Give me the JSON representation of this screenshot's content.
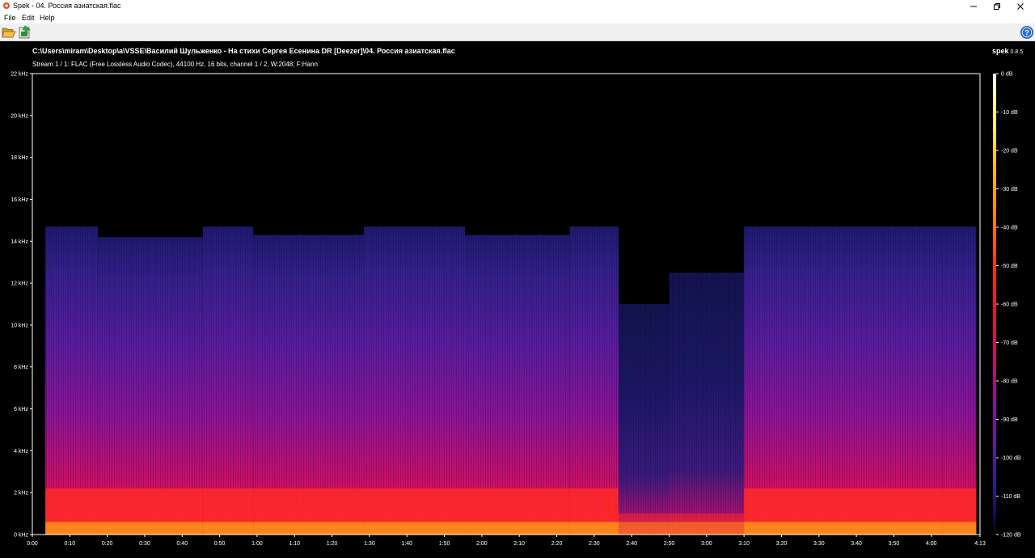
{
  "window": {
    "title": "Spek - 04. Россия азиатская.flac",
    "controls": [
      "minimize-icon",
      "maximize-icon",
      "close-icon"
    ]
  },
  "menu": {
    "items": [
      "File",
      "Edit",
      "Help"
    ]
  },
  "toolbar": {
    "buttons": [
      {
        "name": "open",
        "icon": "folder-open-icon"
      },
      {
        "name": "save",
        "icon": "save-image-icon"
      },
      {
        "name": "help",
        "icon": "help-icon"
      }
    ]
  },
  "spectrogram": {
    "file_path": "C:\\Users\\miram\\Desktop\\a\\VSSE\\Василий Шульженко - На стихи Сергея Есенина DR [Deezer]\\04. Россия азиатская.flac",
    "stream_info": "Stream 1 / 1: FLAC (Free Lossless Audio Codec), 44100 Hz, 16 bits, channel 1 / 2, W:2048, F:Hann",
    "app_name": "spek",
    "app_version": "0.8.5"
  },
  "chart_data": {
    "type": "heatmap",
    "title": "",
    "xlabel": "",
    "ylabel": "",
    "x_range_seconds": [
      0,
      253
    ],
    "y_range_khz": [
      0,
      22
    ],
    "db_range": [
      -120,
      0
    ],
    "freq_ticks": [
      "0 kHz",
      "2 kHz",
      "4 kHz",
      "6 kHz",
      "8 kHz",
      "10 kHz",
      "12 kHz",
      "14 kHz",
      "16 kHz",
      "18 kHz",
      "20 kHz",
      "22 kHz"
    ],
    "freq_tick_values_khz": [
      0,
      2,
      4,
      6,
      8,
      10,
      12,
      14,
      16,
      18,
      20,
      22
    ],
    "time_ticks": [
      "0:00",
      "0:10",
      "0:20",
      "0:30",
      "0:40",
      "0:50",
      "1:00",
      "1:10",
      "1:20",
      "1:30",
      "1:40",
      "1:50",
      "2:00",
      "2:10",
      "2:20",
      "2:30",
      "2:40",
      "2:50",
      "3:00",
      "3:10",
      "3:20",
      "3:30",
      "3:40",
      "3:50",
      "4:00",
      "4:13"
    ],
    "time_tick_values_s": [
      0,
      10,
      20,
      30,
      40,
      50,
      60,
      70,
      80,
      90,
      100,
      110,
      120,
      130,
      140,
      150,
      160,
      170,
      180,
      190,
      200,
      210,
      220,
      230,
      240,
      253
    ],
    "db_ticks": [
      "0 dB",
      "-10 dB",
      "-20 dB",
      "-30 dB",
      "-40 dB",
      "-50 dB",
      "-60 dB",
      "-70 dB",
      "-80 dB",
      "-90 dB",
      "-100 dB",
      "-110 dB",
      "-120 dB"
    ],
    "db_tick_values": [
      0,
      -10,
      -20,
      -30,
      -40,
      -50,
      -60,
      -70,
      -80,
      -90,
      -100,
      -110,
      -120
    ],
    "colormap": [
      "#000000",
      "#0a0a3a",
      "#2a1a80",
      "#5a1aa0",
      "#8a10a0",
      "#c0106a",
      "#e8103a",
      "#ff3010",
      "#ff8000",
      "#ffc000",
      "#ffff60",
      "#ffffff"
    ],
    "signal_segments": [
      {
        "start_s": 3.5,
        "end_s": 17.5,
        "cutoff_khz": 14.7
      },
      {
        "start_s": 17.5,
        "end_s": 45.5,
        "cutoff_khz": 14.2
      },
      {
        "start_s": 45.5,
        "end_s": 59.0,
        "cutoff_khz": 14.7
      },
      {
        "start_s": 59.0,
        "end_s": 88.5,
        "cutoff_khz": 14.3
      },
      {
        "start_s": 88.5,
        "end_s": 115.5,
        "cutoff_khz": 14.7
      },
      {
        "start_s": 115.5,
        "end_s": 143.5,
        "cutoff_khz": 14.3
      },
      {
        "start_s": 143.5,
        "end_s": 156.5,
        "cutoff_khz": 14.7
      },
      {
        "start_s": 156.5,
        "end_s": 170.0,
        "cutoff_khz": 11.0
      },
      {
        "start_s": 170.0,
        "end_s": 190.0,
        "cutoff_khz": 12.5
      },
      {
        "start_s": 190.0,
        "end_s": 243.0,
        "cutoff_khz": 14.7
      },
      {
        "start_s": 243.0,
        "end_s": 252.0,
        "cutoff_khz": 14.7
      }
    ]
  }
}
